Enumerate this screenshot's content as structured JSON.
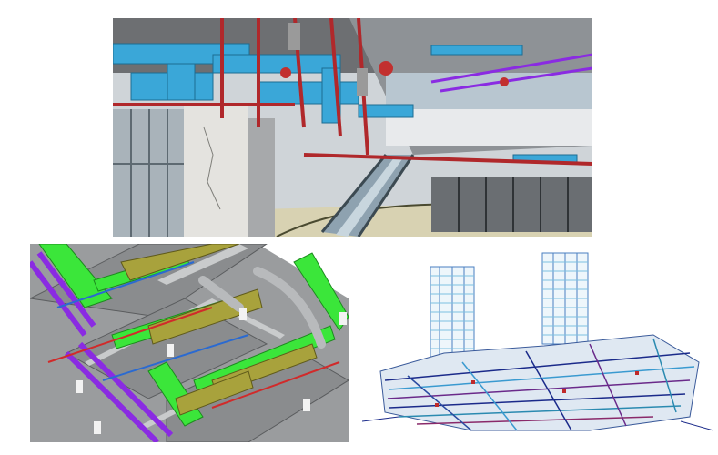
{
  "figure": {
    "panels": [
      {
        "id": "p1",
        "subject": "mall-interior-mep-render"
      },
      {
        "id": "p2",
        "subject": "plant-room-isometric-ducting"
      },
      {
        "id": "p3",
        "subject": "twin-tower-mep-wireframe"
      }
    ]
  },
  "colors": {
    "duct_cyan": "#3aa7d8",
    "pipe_red": "#b0282b",
    "duct_green": "#3be63a",
    "duct_olive": "#a8a23c",
    "pipe_purple": "#8a2be2",
    "wire_blue": "#4a7fc0"
  }
}
